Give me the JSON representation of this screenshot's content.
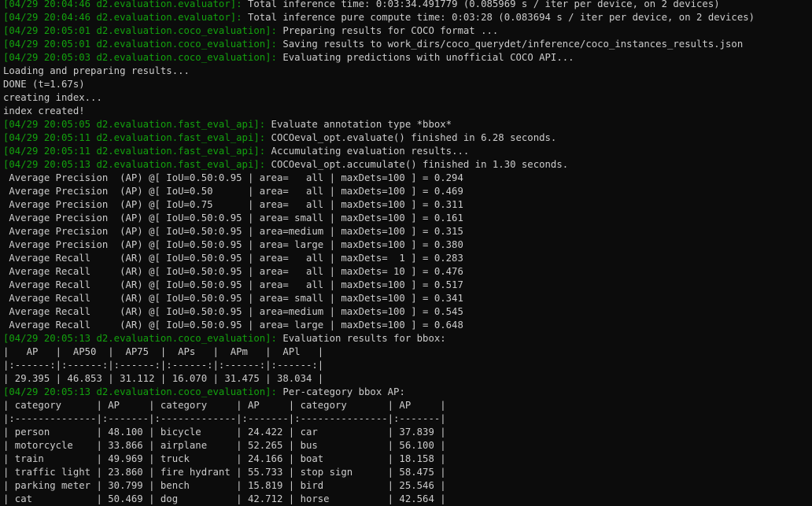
{
  "colors": {
    "background": "#0c0c0c",
    "text": "#cccccc",
    "logger_prefix": "#13a10e"
  },
  "lines": [
    {
      "prefix": "[04/29 20:04:46 d2.evaluation.evaluator]:",
      "text": " Total inference time: 0:03:34.491779 (0.085969 s / iter per device, on 2 devices)"
    },
    {
      "prefix": "[04/29 20:04:46 d2.evaluation.evaluator]:",
      "text": " Total inference pure compute time: 0:03:28 (0.083694 s / iter per device, on 2 devices)"
    },
    {
      "prefix": "[04/29 20:05:01 d2.evaluation.coco_evaluation]:",
      "text": " Preparing results for COCO format ..."
    },
    {
      "prefix": "[04/29 20:05:01 d2.evaluation.coco_evaluation]:",
      "text": " Saving results to work_dirs/coco_querydet/inference/coco_instances_results.json"
    },
    {
      "prefix": "[04/29 20:05:03 d2.evaluation.coco_evaluation]:",
      "text": " Evaluating predictions with unofficial COCO API..."
    },
    {
      "prefix": "",
      "text": "Loading and preparing results..."
    },
    {
      "prefix": "",
      "text": "DONE (t=1.67s)"
    },
    {
      "prefix": "",
      "text": "creating index..."
    },
    {
      "prefix": "",
      "text": "index created!"
    },
    {
      "prefix": "[04/29 20:05:05 d2.evaluation.fast_eval_api]:",
      "text": " Evaluate annotation type *bbox*"
    },
    {
      "prefix": "[04/29 20:05:11 d2.evaluation.fast_eval_api]:",
      "text": " COCOeval_opt.evaluate() finished in 6.28 seconds."
    },
    {
      "prefix": "[04/29 20:05:11 d2.evaluation.fast_eval_api]:",
      "text": " Accumulating evaluation results..."
    },
    {
      "prefix": "[04/29 20:05:13 d2.evaluation.fast_eval_api]:",
      "text": " COCOeval_opt.accumulate() finished in 1.30 seconds."
    },
    {
      "prefix": "",
      "text": " Average Precision  (AP) @[ IoU=0.50:0.95 | area=   all | maxDets=100 ] = 0.294"
    },
    {
      "prefix": "",
      "text": " Average Precision  (AP) @[ IoU=0.50      | area=   all | maxDets=100 ] = 0.469"
    },
    {
      "prefix": "",
      "text": " Average Precision  (AP) @[ IoU=0.75      | area=   all | maxDets=100 ] = 0.311"
    },
    {
      "prefix": "",
      "text": " Average Precision  (AP) @[ IoU=0.50:0.95 | area= small | maxDets=100 ] = 0.161"
    },
    {
      "prefix": "",
      "text": " Average Precision  (AP) @[ IoU=0.50:0.95 | area=medium | maxDets=100 ] = 0.315"
    },
    {
      "prefix": "",
      "text": " Average Precision  (AP) @[ IoU=0.50:0.95 | area= large | maxDets=100 ] = 0.380"
    },
    {
      "prefix": "",
      "text": " Average Recall     (AR) @[ IoU=0.50:0.95 | area=   all | maxDets=  1 ] = 0.283"
    },
    {
      "prefix": "",
      "text": " Average Recall     (AR) @[ IoU=0.50:0.95 | area=   all | maxDets= 10 ] = 0.476"
    },
    {
      "prefix": "",
      "text": " Average Recall     (AR) @[ IoU=0.50:0.95 | area=   all | maxDets=100 ] = 0.517"
    },
    {
      "prefix": "",
      "text": " Average Recall     (AR) @[ IoU=0.50:0.95 | area= small | maxDets=100 ] = 0.341"
    },
    {
      "prefix": "",
      "text": " Average Recall     (AR) @[ IoU=0.50:0.95 | area=medium | maxDets=100 ] = 0.545"
    },
    {
      "prefix": "",
      "text": " Average Recall     (AR) @[ IoU=0.50:0.95 | area= large | maxDets=100 ] = 0.648"
    },
    {
      "prefix": "[04/29 20:05:13 d2.evaluation.coco_evaluation]:",
      "text": " Evaluation results for bbox:"
    },
    {
      "prefix": "",
      "text": "|   AP   |  AP50  |  AP75  |  APs   |  APm   |  APl   |"
    },
    {
      "prefix": "",
      "text": "|:------:|:------:|:------:|:------:|:------:|:------:|"
    },
    {
      "prefix": "",
      "text": "| 29.395 | 46.853 | 31.112 | 16.070 | 31.475 | 38.034 |"
    },
    {
      "prefix": "[04/29 20:05:13 d2.evaluation.coco_evaluation]:",
      "text": " Per-category bbox AP:"
    },
    {
      "prefix": "",
      "text": "| category      | AP     | category     | AP     | category       | AP     |"
    },
    {
      "prefix": "",
      "text": "|:--------------|:-------|:-------------|:-------|:---------------|:-------|"
    },
    {
      "prefix": "",
      "text": "| person        | 48.100 | bicycle      | 24.422 | car            | 37.839 |"
    },
    {
      "prefix": "",
      "text": "| motorcycle    | 33.866 | airplane     | 52.265 | bus            | 56.100 |"
    },
    {
      "prefix": "",
      "text": "| train         | 49.969 | truck        | 24.166 | boat           | 18.158 |"
    },
    {
      "prefix": "",
      "text": "| traffic light | 23.860 | fire hydrant | 55.733 | stop sign      | 58.475 |"
    },
    {
      "prefix": "",
      "text": "| parking meter | 30.799 | bench        | 15.819 | bird           | 25.546 |"
    },
    {
      "prefix": "",
      "text": "| cat           | 50.469 | dog          | 42.712 | horse          | 42.564 |"
    }
  ]
}
